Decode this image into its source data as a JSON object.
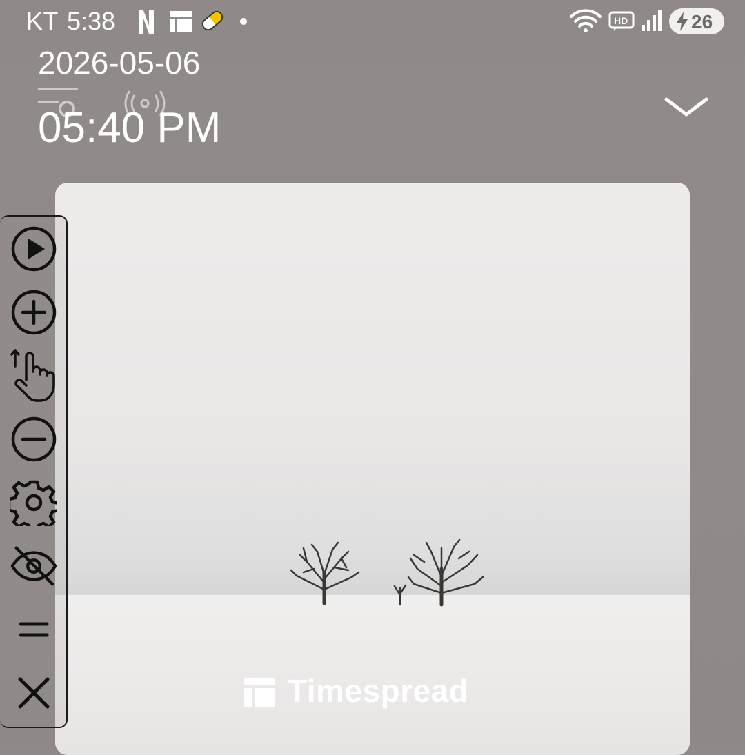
{
  "status_bar": {
    "carrier": "KT",
    "time": "5:38",
    "battery_level": "26",
    "icons": [
      "netflix-icon",
      "app-grid-icon",
      "pill-icon",
      "wifi-icon",
      "hd-icon",
      "signal-icon",
      "battery-charging-icon"
    ]
  },
  "clock_widget": {
    "date": "2026-05-06",
    "time": "05:40 PM"
  },
  "card": {
    "brand": "Timespread"
  },
  "toolbar": {
    "buttons": [
      "play-icon",
      "zoom-in-icon",
      "swipe-up-gesture-icon",
      "zoom-out-icon",
      "settings-icon",
      "hide-icon",
      "drag-handle-icon",
      "close-icon"
    ]
  },
  "colors": {
    "background": "#8f8a88",
    "text": "#ffffff",
    "toolbar_border": "#1a1a1a"
  }
}
